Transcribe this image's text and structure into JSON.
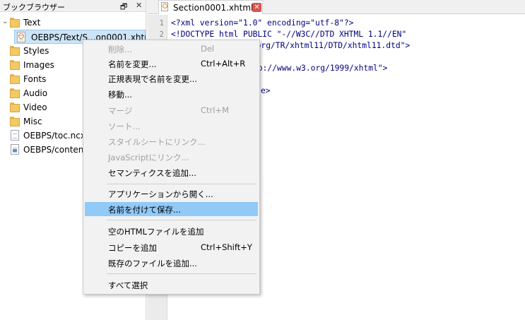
{
  "book_browser": {
    "title": "ブックブラウザー",
    "float_icon": "restore-icon",
    "close_icon": "close-icon",
    "items": [
      {
        "label": "Text",
        "type": "folder",
        "expanded": true
      },
      {
        "label": "OEBPS/Text/S...on0001.xhtml",
        "type": "xhtml-file",
        "selected": true
      },
      {
        "label": "Styles",
        "type": "folder"
      },
      {
        "label": "Images",
        "type": "folder"
      },
      {
        "label": "Fonts",
        "type": "folder"
      },
      {
        "label": "Audio",
        "type": "folder"
      },
      {
        "label": "Video",
        "type": "folder"
      },
      {
        "label": "Misc",
        "type": "folder"
      },
      {
        "label": "OEBPS/toc.ncx",
        "type": "file"
      },
      {
        "label": "OEBPS/content.",
        "type": "opf-file"
      }
    ]
  },
  "editor": {
    "tab_label": "Section0001.xhtml",
    "line_numbers": [
      "1",
      "2"
    ],
    "lines": [
      "<?xml version=\"1.0\" encoding=\"utf-8\"?>",
      "<!DOCTYPE html PUBLIC \"-//W3C//DTD XHTML 1.1//EN\"",
      "3.org/TR/xhtml11/DTD/xhtml11.dtd\">",
      "tp://www.w3.org/1999/xhtml\">",
      "e>"
    ]
  },
  "context_menu": {
    "items": [
      {
        "label": "削除...",
        "shortcut": "Del",
        "disabled": true
      },
      {
        "label": "名前を変更...",
        "shortcut": "Ctrl+Alt+R"
      },
      {
        "label": "正規表現で名前を変更...",
        "shortcut": ""
      },
      {
        "label": "移動...",
        "shortcut": ""
      },
      {
        "label": "マージ",
        "shortcut": "Ctrl+M",
        "disabled": true
      },
      {
        "label": "ソート...",
        "shortcut": "",
        "disabled": true
      },
      {
        "label": "スタイルシートにリンク...",
        "shortcut": "",
        "disabled": true
      },
      {
        "label": "JavaScriptにリンク...",
        "shortcut": "",
        "disabled": true
      },
      {
        "label": "セマンティクスを追加...",
        "shortcut": ""
      },
      {
        "label": "アプリケーションから開く...",
        "shortcut": ""
      },
      {
        "label": "名前を付けて保存...",
        "shortcut": "",
        "highlighted": true
      },
      {
        "label": "空のHTMLファイルを追加",
        "shortcut": ""
      },
      {
        "label": "コピーを追加",
        "shortcut": "Ctrl+Shift+Y"
      },
      {
        "label": "既存のファイルを追加...",
        "shortcut": ""
      },
      {
        "label": "すべて選択",
        "shortcut": ""
      }
    ]
  },
  "colors": {
    "selection": "#cce4f7",
    "menu_highlight": "#91c9f7",
    "code_tag": "#000080",
    "code_string": "#7a2f9a"
  }
}
